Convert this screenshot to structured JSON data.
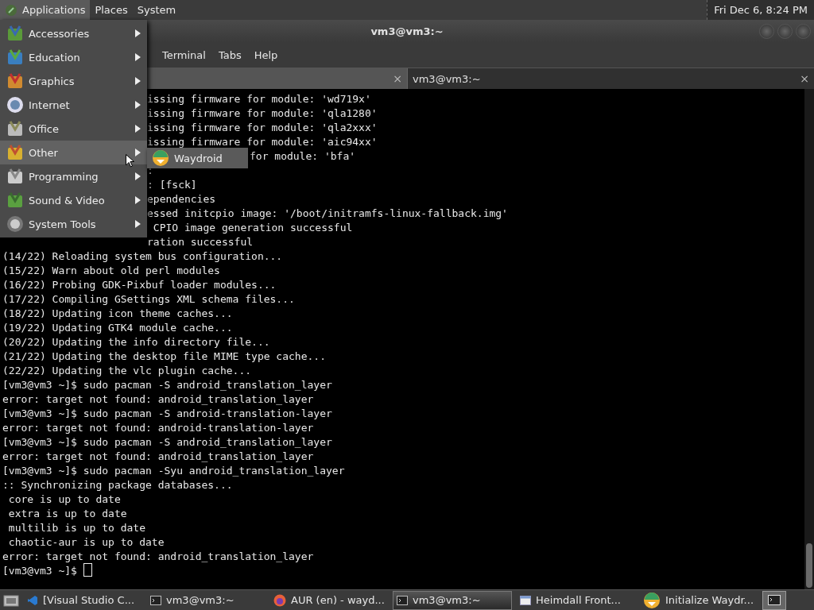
{
  "top_panel": {
    "menus": [
      {
        "label": "Applications",
        "selected": true
      },
      {
        "label": "Places",
        "selected": false
      },
      {
        "label": "System",
        "selected": false
      }
    ],
    "clock": "Fri Dec 6,  8:24 PM"
  },
  "window": {
    "title": "vm3@vm3:~",
    "menubar": [
      "Terminal",
      "Tabs",
      "Help"
    ],
    "tabs": [
      {
        "close": "×",
        "selected": false
      },
      {
        "label": "vm3@vm3:~",
        "close": "×",
        "selected": true
      }
    ]
  },
  "terminal": {
    "lines": [
      {
        "kind": "under-menu",
        "text": "issing firmware for module: 'wd719x'"
      },
      {
        "kind": "under-menu",
        "text": "issing firmware for module: 'qla1280'"
      },
      {
        "kind": "under-menu",
        "text": "issing firmware for module: 'qla2xxx'"
      },
      {
        "kind": "under-menu",
        "text": "issing firmware for module: 'aic94xx'"
      },
      {
        "kind": "under-submenu",
        "text": "for module: 'bfa'"
      },
      {
        "kind": "under-menu",
        "text": ":"
      },
      {
        "kind": "under-menu",
        "text": ": [fsck]"
      },
      {
        "kind": "under-menu",
        "text": "ependencies"
      },
      {
        "kind": "under-menu",
        "text": "essed initcpio image: '/boot/initramfs-linux-fallback.img'"
      },
      {
        "kind": "under-menu",
        "text": " CPIO image generation successful"
      },
      {
        "kind": "under-menu",
        "text": "ration successful"
      },
      {
        "kind": "plain",
        "text": "(14/22) Reloading system bus configuration..."
      },
      {
        "kind": "plain",
        "text": "(15/22) Warn about old perl modules"
      },
      {
        "kind": "plain",
        "text": "(16/22) Probing GDK-Pixbuf loader modules..."
      },
      {
        "kind": "plain",
        "text": "(17/22) Compiling GSettings XML schema files..."
      },
      {
        "kind": "plain",
        "text": "(18/22) Updating icon theme caches..."
      },
      {
        "kind": "plain",
        "text": "(19/22) Updating GTK4 module cache..."
      },
      {
        "kind": "plain",
        "text": "(20/22) Updating the info directory file..."
      },
      {
        "kind": "plain",
        "text": "(21/22) Updating the desktop file MIME type cache..."
      },
      {
        "kind": "plain",
        "text": "(22/22) Updating the vlc plugin cache..."
      },
      {
        "kind": "plain",
        "text": "[vm3@vm3 ~]$ sudo pacman -S android_translation_layer"
      },
      {
        "kind": "plain",
        "text": "error: target not found: android_translation_layer"
      },
      {
        "kind": "plain",
        "text": "[vm3@vm3 ~]$ sudo pacman -S android-translation-layer"
      },
      {
        "kind": "plain",
        "text": "error: target not found: android-translation-layer"
      },
      {
        "kind": "plain",
        "text": "[vm3@vm3 ~]$ sudo pacman -S android_translation_layer"
      },
      {
        "kind": "plain",
        "text": "error: target not found: android_translation_layer"
      },
      {
        "kind": "plain",
        "text": "[vm3@vm3 ~]$ sudo pacman -Syu android_translation_layer"
      },
      {
        "kind": "plain",
        "text": ":: Synchronizing package databases..."
      },
      {
        "kind": "plain",
        "text": " core is up to date"
      },
      {
        "kind": "plain",
        "text": " extra is up to date"
      },
      {
        "kind": "plain",
        "text": " multilib is up to date"
      },
      {
        "kind": "plain",
        "text": " chaotic-aur is up to date"
      },
      {
        "kind": "plain",
        "text": "error: target not found: android_translation_layer"
      },
      {
        "kind": "prompt",
        "text": "[vm3@vm3 ~]$ "
      }
    ]
  },
  "app_menu": {
    "items": [
      {
        "label": "Accessories",
        "kind": "accessories",
        "selected": false
      },
      {
        "label": "Education",
        "kind": "education",
        "selected": false
      },
      {
        "label": "Graphics",
        "kind": "graphics",
        "selected": false
      },
      {
        "label": "Internet",
        "kind": "internet",
        "selected": false
      },
      {
        "label": "Office",
        "kind": "office",
        "selected": false
      },
      {
        "label": "Other",
        "kind": "other",
        "selected": true
      },
      {
        "label": "Programming",
        "kind": "programming",
        "selected": false
      },
      {
        "label": "Sound & Video",
        "kind": "sound",
        "selected": false
      },
      {
        "label": "System Tools",
        "kind": "tools",
        "selected": false
      }
    ],
    "submenu": [
      {
        "label": "Waydroid"
      }
    ]
  },
  "taskbar": {
    "items": [
      {
        "label": "[Visual Studio C...",
        "kind": "code",
        "selected": false
      },
      {
        "label": "vm3@vm3:~",
        "kind": "terminal",
        "selected": false
      },
      {
        "label": "AUR (en) - wayd...",
        "kind": "browser",
        "selected": false
      },
      {
        "label": "vm3@vm3:~",
        "kind": "terminal",
        "selected": true
      },
      {
        "label": "Heimdall Front...",
        "kind": "window",
        "selected": false
      },
      {
        "label": "Initialize Waydr...",
        "kind": "waydroid",
        "selected": false
      }
    ]
  }
}
